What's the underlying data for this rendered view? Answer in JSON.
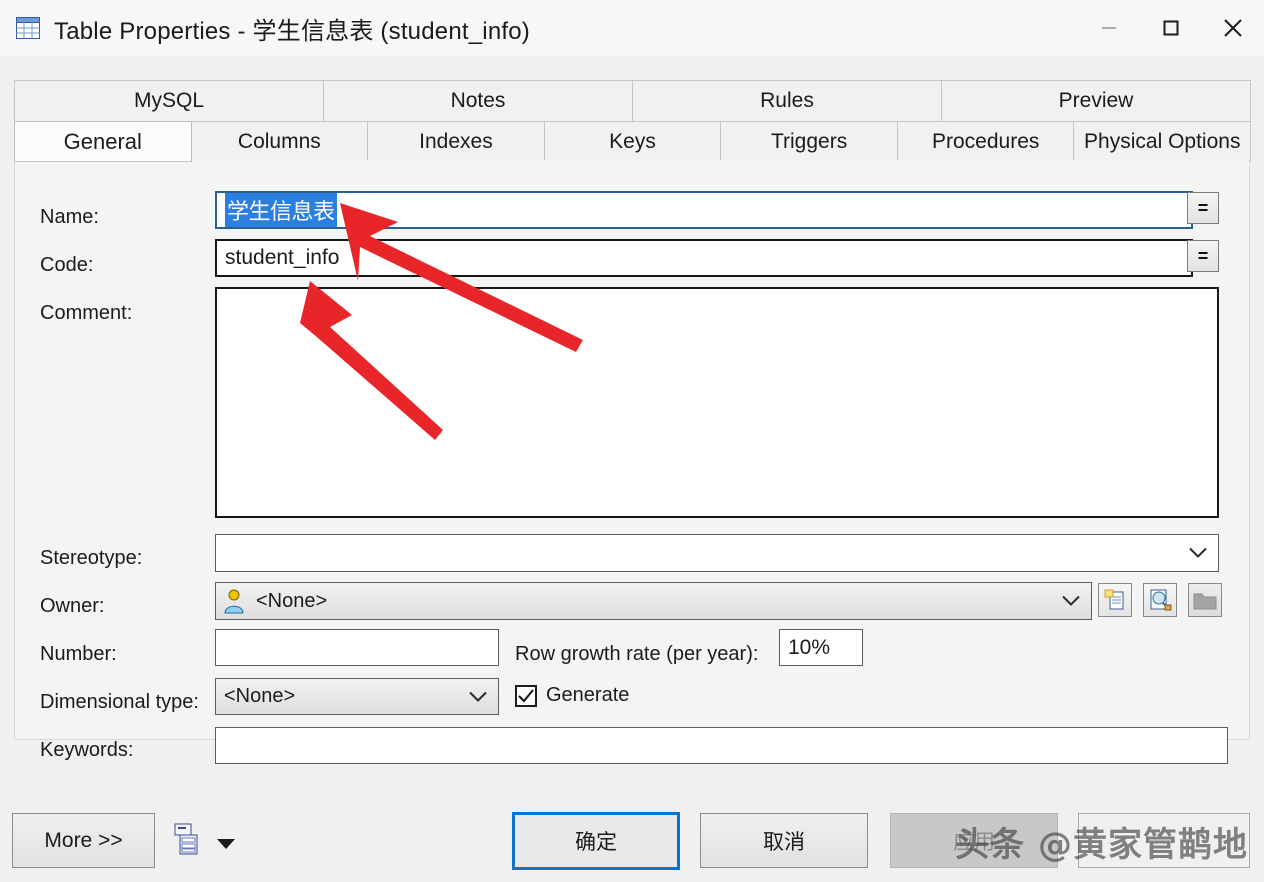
{
  "window": {
    "icon": "table-grid-icon",
    "title": "Table Properties - 学生信息表 (student_info)",
    "minimize_label": "—",
    "maximize_label": "□",
    "close_label": "✕"
  },
  "tabs": {
    "row1": [
      {
        "label": "MySQL",
        "active": false
      },
      {
        "label": "Notes",
        "active": false
      },
      {
        "label": "Rules",
        "active": false
      },
      {
        "label": "Preview",
        "active": false
      }
    ],
    "row2": [
      {
        "label": "General",
        "active": true
      },
      {
        "label": "Columns",
        "active": false
      },
      {
        "label": "Indexes",
        "active": false
      },
      {
        "label": "Keys",
        "active": false
      },
      {
        "label": "Triggers",
        "active": false
      },
      {
        "label": "Procedures",
        "active": false
      },
      {
        "label": "Physical Options",
        "active": false
      }
    ]
  },
  "form": {
    "name": {
      "label": "Name:",
      "value": "学生信息表",
      "selected": true,
      "equals_button": "=",
      "focused": true
    },
    "code": {
      "label": "Code:",
      "value": "student_info",
      "equals_button": "="
    },
    "comment": {
      "label": "Comment:",
      "value": ""
    },
    "stereotype": {
      "label": "Stereotype:",
      "value": ""
    },
    "owner": {
      "label": "Owner:",
      "value": "<None>",
      "icon": "user-icon",
      "buttons": [
        {
          "name": "create-object-button",
          "icon": "new-document-icon",
          "disabled": false
        },
        {
          "name": "object-properties-button",
          "icon": "magnifier-document-icon",
          "disabled": false
        },
        {
          "name": "select-object-button",
          "icon": "folder-icon",
          "disabled": true
        }
      ]
    },
    "number": {
      "label": "Number:",
      "value": ""
    },
    "row_growth": {
      "label": "Row growth rate (per year):",
      "value": "10%"
    },
    "dimensional_type": {
      "label": "Dimensional type:",
      "value": "<None>"
    },
    "generate": {
      "label": "Generate",
      "checked": true
    },
    "keywords": {
      "label": "Keywords:",
      "value": ""
    }
  },
  "footer": {
    "more": "More >>",
    "report_icon": "report-list-icon",
    "report_dropdown_icon": "caret-down-icon",
    "ok": "确定",
    "cancel": "取消",
    "apply": "应用",
    "apply_disabled": true
  },
  "annotations": {
    "arrows": [
      {
        "name": "arrow-to-name-field",
        "color": "#e8262a"
      },
      {
        "name": "arrow-to-code-field",
        "color": "#e8262a"
      }
    ]
  },
  "watermark": {
    "text": "头条 @黄家管鹋地"
  },
  "colors": {
    "accent": "#0a74d4",
    "selection": "#2a7fe0",
    "annotation": "#e8262a",
    "window_bg": "#f0f0f0"
  }
}
